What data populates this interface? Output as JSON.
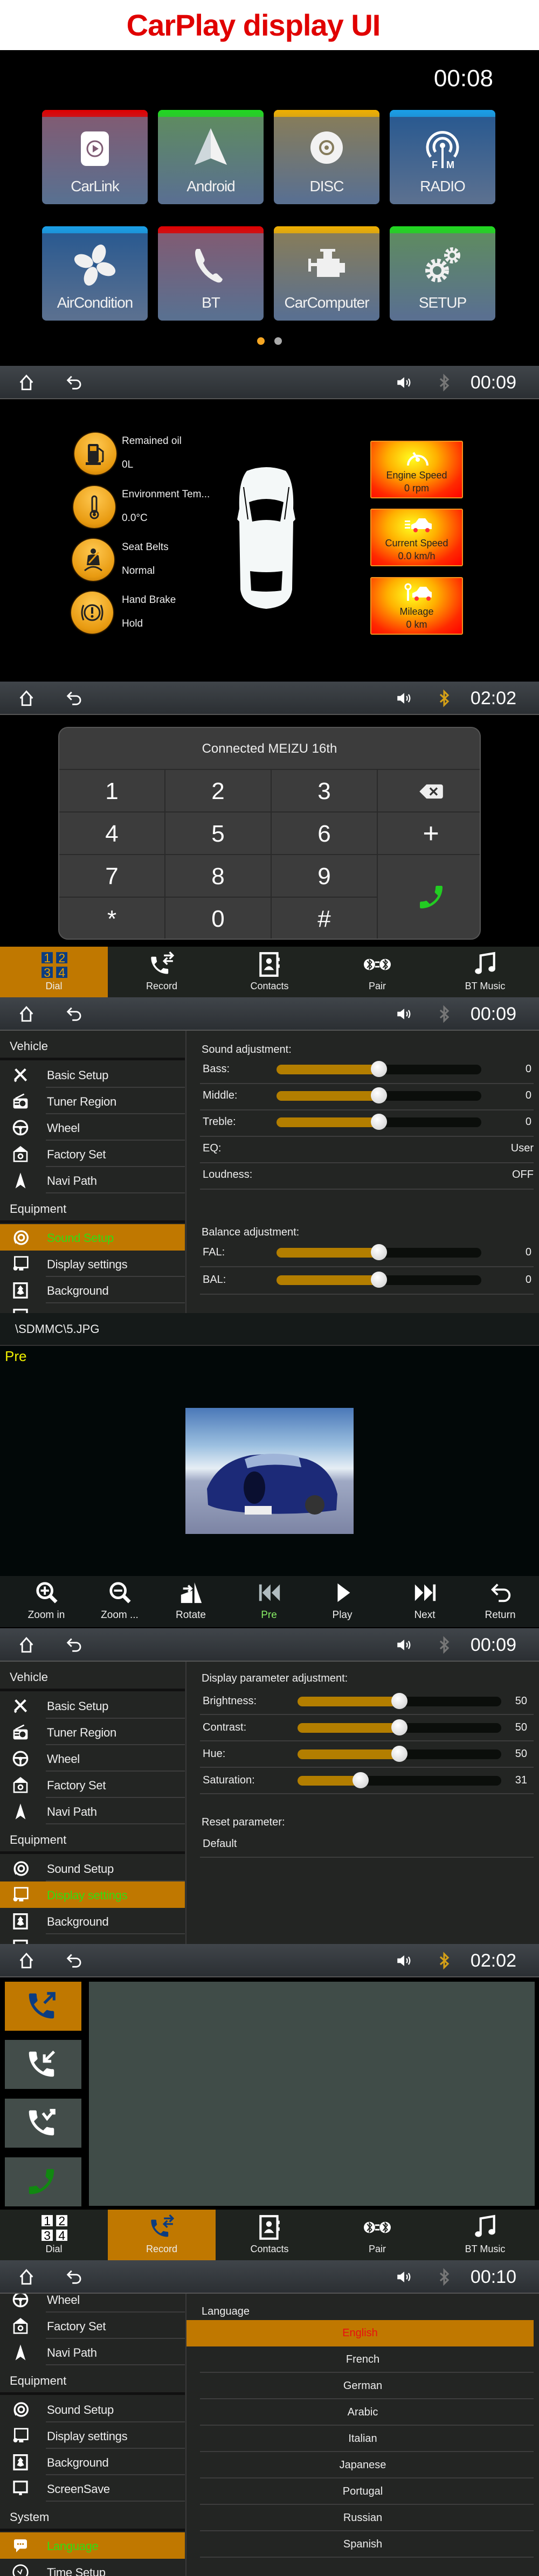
{
  "header": {
    "title": "CarPlay display UI"
  },
  "home": {
    "clock": "00:08",
    "tiles": [
      {
        "label": "CarLink",
        "icon": "carlink-icon",
        "accent": "#e00000",
        "tint": "#7f5c74"
      },
      {
        "label": "Android",
        "icon": "navigation-arrow-icon",
        "accent": "#1fd81f",
        "tint": "#5e8a62"
      },
      {
        "label": "DISC",
        "icon": "disc-icon",
        "accent": "#f0b000",
        "tint": "#857c5c"
      },
      {
        "label": "RADIO",
        "icon": "radio-antenna-icon",
        "accent": "#1aa0e8",
        "tint": "#2b5a90"
      },
      {
        "label": "AirCondition",
        "icon": "fan-icon",
        "accent": "#1aa0e8",
        "tint": "#2b5a90"
      },
      {
        "label": "BT",
        "icon": "phone-icon",
        "accent": "#e00000",
        "tint": "#7f5c74"
      },
      {
        "label": "CarComputer",
        "icon": "engine-icon",
        "accent": "#f0b000",
        "tint": "#857c5c"
      },
      {
        "label": "SETUP",
        "icon": "gears-icon",
        "accent": "#1fd81f",
        "tint": "#5e8a62"
      }
    ],
    "page_indicator": {
      "pages": 2,
      "current": 1,
      "active_color": "#f5a623",
      "inactive_color": "#aaaaaa"
    }
  },
  "toolbars": [
    {
      "time": "00:09",
      "bluetooth_connected": false
    },
    {
      "time": "02:02",
      "bluetooth_connected": true
    },
    {
      "time": "00:09",
      "bluetooth_connected": false
    },
    {
      "time": "00:09",
      "bluetooth_connected": false
    },
    {
      "time": "02:02",
      "bluetooth_connected": true
    },
    {
      "time": "00:10",
      "bluetooth_connected": false
    }
  ],
  "car_computer": {
    "status": [
      {
        "label": "Remained oil",
        "value": "0L",
        "icon": "fuel-pump-icon"
      },
      {
        "label": "Environment Tem...",
        "value": "0.0°C",
        "icon": "thermometer-icon"
      },
      {
        "label": "Seat Belts",
        "value": "Normal",
        "icon": "seat-belt-icon"
      },
      {
        "label": "Hand Brake",
        "value": "Hold",
        "icon": "hand-brake-icon"
      }
    ],
    "gauges": [
      {
        "label": "Engine Speed",
        "value": "0 rpm",
        "icon": "speedometer-icon"
      },
      {
        "label": "Current Speed",
        "value": "0.0 km/h",
        "icon": "speeding-car-icon"
      },
      {
        "label": "Mileage",
        "value": "0 km",
        "icon": "mileage-car-icon"
      }
    ]
  },
  "dialpad": {
    "title": "Connected MEIZU 16th",
    "keys": [
      "1",
      "2",
      "3",
      "4",
      "5",
      "6",
      "7",
      "8",
      "9",
      "*",
      "0",
      "#"
    ],
    "call_color": "#22cc22"
  },
  "bt_tabs": {
    "items": [
      {
        "label": "Dial",
        "icon": "dialpad-icon"
      },
      {
        "label": "Record",
        "icon": "call-log-icon"
      },
      {
        "label": "Contacts",
        "icon": "contacts-icon"
      },
      {
        "label": "Pair",
        "icon": "bluetooth-pair-icon"
      },
      {
        "label": "BT Music",
        "icon": "music-note-icon"
      }
    ],
    "active_in_dial_screen": "Dial",
    "active_in_record_screen": "Record",
    "active_color": "#c07800"
  },
  "sound_settings": {
    "sidebar": [
      {
        "type": "header",
        "label": "Vehicle"
      },
      {
        "type": "item",
        "label": "Basic Setup",
        "icon": "tools-icon"
      },
      {
        "type": "item",
        "label": "Tuner Region",
        "icon": "radio-icon"
      },
      {
        "type": "item",
        "label": "Wheel",
        "icon": "steering-wheel-icon"
      },
      {
        "type": "item",
        "label": "Factory Set",
        "icon": "factory-icon"
      },
      {
        "type": "item",
        "label": "Navi Path",
        "icon": "navigation-icon"
      },
      {
        "type": "header",
        "label": "Equipment"
      },
      {
        "type": "item",
        "label": "Sound Setup",
        "icon": "speaker-icon",
        "active": true
      },
      {
        "type": "item",
        "label": "Display settings",
        "icon": "display-icon"
      },
      {
        "type": "item",
        "label": "Background",
        "icon": "background-icon"
      },
      {
        "type": "item",
        "label": "",
        "icon": "screensave-icon"
      }
    ],
    "title": "Sound adjustment:",
    "sliders": [
      {
        "label": "Bass:",
        "value": "0",
        "position_percent": 50
      },
      {
        "label": "Middle:",
        "value": "0",
        "position_percent": 50
      },
      {
        "label": "Treble:",
        "value": "0",
        "position_percent": 50
      }
    ],
    "options": [
      {
        "label": "EQ:",
        "value": "User"
      },
      {
        "label": "Loudness:",
        "value": "OFF"
      }
    ],
    "balance_title": "Balance adjustment:",
    "balance_sliders": [
      {
        "label": "FAL:",
        "value": "0",
        "position_percent": 50
      },
      {
        "label": "BAL:",
        "value": "0",
        "position_percent": 50
      }
    ]
  },
  "photo_viewer": {
    "path": "\\SDMMC\\5.JPG",
    "status": "Pre",
    "controls": [
      {
        "label": "Zoom in",
        "icon": "zoom-in-icon"
      },
      {
        "label": "Zoom ...",
        "icon": "zoom-out-icon"
      },
      {
        "label": "Rotate",
        "icon": "rotate-icon"
      },
      {
        "label": "Pre",
        "icon": "previous-icon",
        "active": true
      },
      {
        "label": "Play",
        "icon": "play-icon"
      },
      {
        "label": "Next",
        "icon": "next-icon"
      },
      {
        "label": "Return",
        "icon": "return-icon"
      }
    ]
  },
  "display_settings": {
    "sidebar": [
      {
        "type": "header",
        "label": "Vehicle"
      },
      {
        "type": "item",
        "label": "Basic Setup",
        "icon": "tools-icon"
      },
      {
        "type": "item",
        "label": "Tuner Region",
        "icon": "radio-icon"
      },
      {
        "type": "item",
        "label": "Wheel",
        "icon": "steering-wheel-icon"
      },
      {
        "type": "item",
        "label": "Factory Set",
        "icon": "factory-icon"
      },
      {
        "type": "item",
        "label": "Navi Path",
        "icon": "navigation-icon"
      },
      {
        "type": "header",
        "label": "Equipment"
      },
      {
        "type": "item",
        "label": "Sound Setup",
        "icon": "speaker-icon"
      },
      {
        "type": "item",
        "label": "Display settings",
        "icon": "display-icon",
        "active": true
      },
      {
        "type": "item",
        "label": "Background",
        "icon": "background-icon"
      },
      {
        "type": "item",
        "label": "",
        "icon": "screensave-icon"
      }
    ],
    "title": "Display parameter adjustment:",
    "sliders": [
      {
        "label": "Brightness:",
        "value": "50",
        "position_percent": 50
      },
      {
        "label": "Contrast:",
        "value": "50",
        "position_percent": 50
      },
      {
        "label": "Hue:",
        "value": "50",
        "position_percent": 50
      },
      {
        "label": "Saturation:",
        "value": "31",
        "position_percent": 31
      }
    ],
    "reset_title": "Reset parameter:",
    "reset_option": "Default"
  },
  "call_record": {
    "filters": [
      {
        "icon": "outgoing-call-icon",
        "active": true
      },
      {
        "icon": "incoming-call-icon"
      },
      {
        "icon": "missed-call-icon"
      },
      {
        "icon": "call-icon"
      }
    ]
  },
  "language_settings": {
    "sidebar": [
      {
        "type": "item",
        "label": "Wheel",
        "icon": "steering-wheel-icon"
      },
      {
        "type": "item",
        "label": "Factory Set",
        "icon": "factory-icon"
      },
      {
        "type": "item",
        "label": "Navi Path",
        "icon": "navigation-icon"
      },
      {
        "type": "header",
        "label": "Equipment"
      },
      {
        "type": "item",
        "label": "Sound Setup",
        "icon": "speaker-icon"
      },
      {
        "type": "item",
        "label": "Display settings",
        "icon": "display-icon"
      },
      {
        "type": "item",
        "label": "Background",
        "icon": "background-icon"
      },
      {
        "type": "item",
        "label": "ScreenSave",
        "icon": "screensave-icon"
      },
      {
        "type": "header",
        "label": "System"
      },
      {
        "type": "item",
        "label": "Language",
        "icon": "language-icon",
        "active": true
      },
      {
        "type": "item",
        "label": "Time Setup",
        "icon": "clock-icon"
      }
    ],
    "title": "Language",
    "languages": [
      "English",
      "French",
      "German",
      "Arabic",
      "Italian",
      "Japanese",
      "Portugal",
      "Russian",
      "Spanish"
    ],
    "selected": "English"
  }
}
